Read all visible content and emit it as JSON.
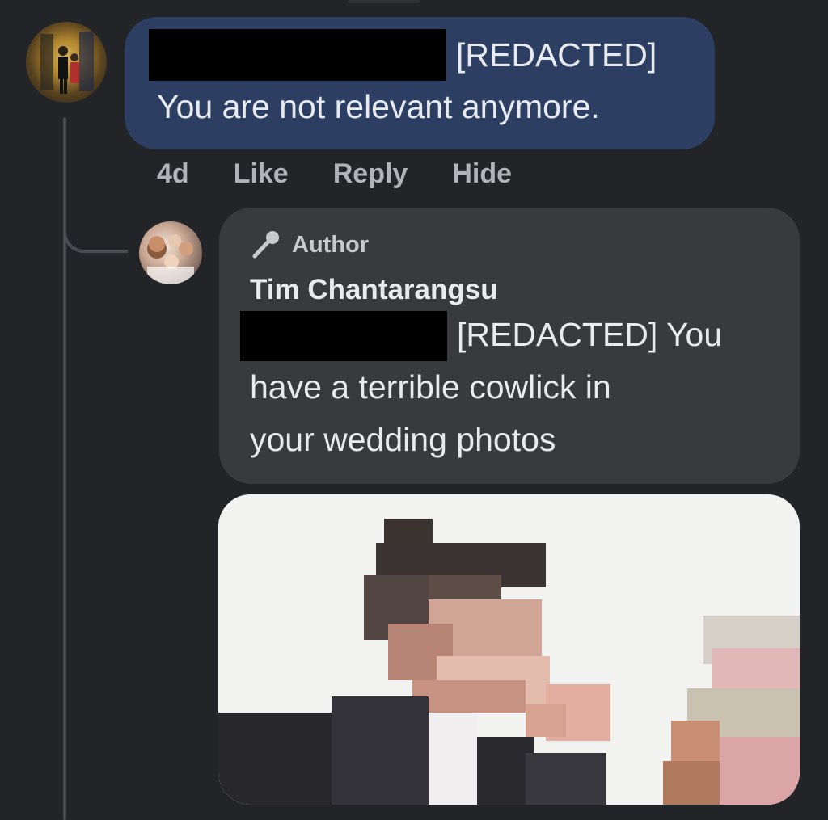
{
  "main_comment": {
    "redacted_label": "[REDACTED]",
    "text": "You are not relevant anymore.",
    "time": "4d",
    "actions": [
      "Like",
      "Reply",
      "Hide"
    ]
  },
  "reply": {
    "badge": "Author",
    "author_name": "Tim Chantarangsu",
    "redacted_label": "[REDACTED] You",
    "line2": "have a terrible cowlick in",
    "line3": "your wedding photos"
  },
  "colors": {
    "background": "#232427",
    "main_bubble": "#2c3f63",
    "reply_bubble": "#393a3e",
    "action_text": "#b0b3b8"
  },
  "icons": {
    "badge": "microphone-icon"
  }
}
